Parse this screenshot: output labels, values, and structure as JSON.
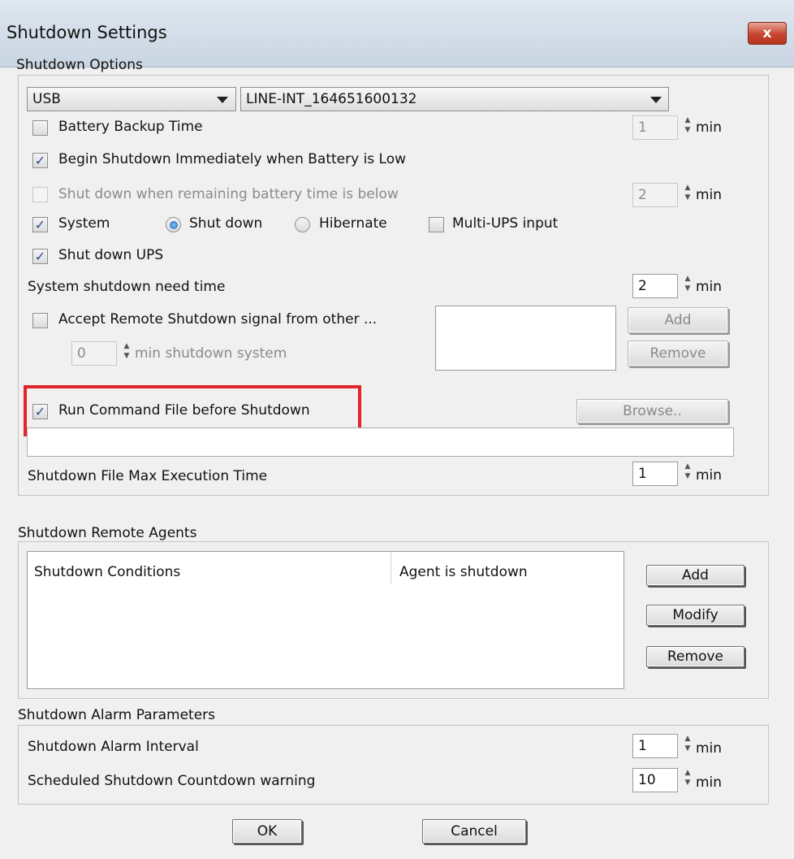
{
  "window": {
    "title": "Shutdown Settings",
    "close_glyph": "x"
  },
  "shutdown_options": {
    "group_label": "Shutdown Options",
    "connection_type": "USB",
    "device": "LINE-INT_164651600132",
    "battery_backup_time": {
      "label": "Battery Backup Time",
      "checked": false,
      "value": "1",
      "unit": "min"
    },
    "begin_shutdown_low": {
      "label": "Begin Shutdown Immediately when Battery is Low",
      "checked": true
    },
    "remaining_battery": {
      "label": "Shut down when remaining battery time is below",
      "checked": false,
      "enabled": false,
      "value": "2",
      "unit": "min"
    },
    "system": {
      "label": "System",
      "checked": true
    },
    "mode_shutdown": {
      "label": "Shut down",
      "selected": true
    },
    "mode_hibernate": {
      "label": "Hibernate",
      "selected": false
    },
    "multi_ups": {
      "label": "Multi-UPS input",
      "checked": false
    },
    "shutdown_ups": {
      "label": "Shut down UPS",
      "checked": true
    },
    "system_need_time": {
      "label": "System shutdown need time",
      "value": "2",
      "unit": "min"
    },
    "remote_accept": {
      "label": "Accept Remote Shutdown signal from other ...",
      "checked": false,
      "value": "0",
      "suffix": "min shutdown system"
    },
    "add_label": "Add",
    "remove_label": "Remove",
    "run_command": {
      "label": "Run Command File before Shutdown",
      "checked": true
    },
    "browse_label": "Browse..",
    "command_path": "",
    "file_max_time": {
      "label": "Shutdown File Max Execution Time",
      "value": "1",
      "unit": "min"
    }
  },
  "remote_agents": {
    "group_label": "Shutdown Remote Agents",
    "columns": [
      "Shutdown Conditions",
      "Agent is shutdown"
    ],
    "add_label": "Add",
    "modify_label": "Modify",
    "remove_label": "Remove"
  },
  "alarm": {
    "group_label": "Shutdown Alarm Parameters",
    "interval": {
      "label": "Shutdown Alarm Interval",
      "value": "1",
      "unit": "min"
    },
    "countdown": {
      "label": "Scheduled Shutdown Countdown warning",
      "value": "10",
      "unit": "min"
    }
  },
  "footer": {
    "ok_label": "OK",
    "cancel_label": "Cancel"
  },
  "colors": {
    "highlight": "#e1232b",
    "check": "#2b4d8f"
  }
}
